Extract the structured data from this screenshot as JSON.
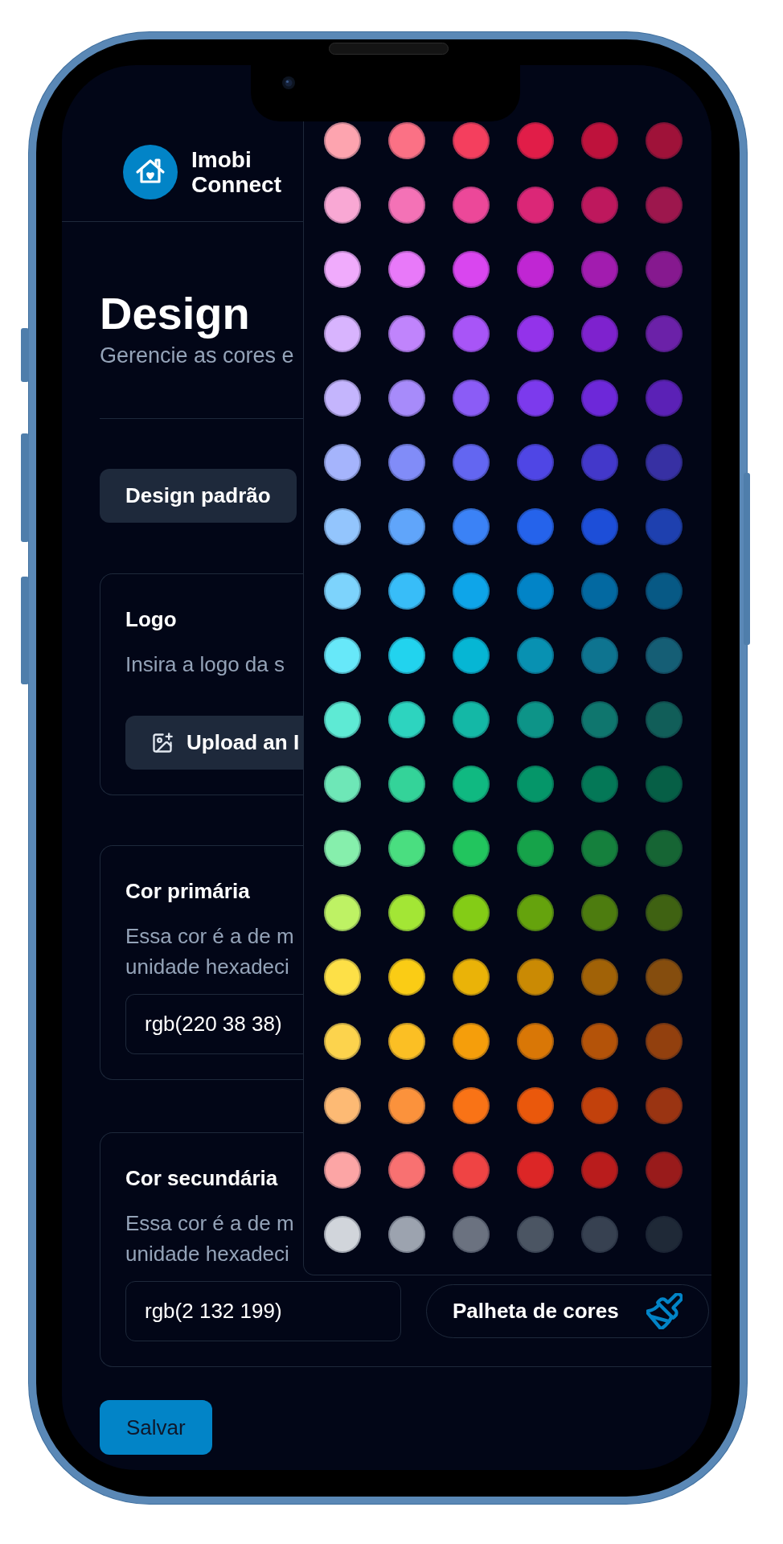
{
  "brand": {
    "name": "Imobi Connect"
  },
  "page": {
    "title": "Design",
    "subtitle": "Gerencie as cores e"
  },
  "default_design_button": {
    "label": "Design padrão"
  },
  "sections": [
    {
      "kind": "logo",
      "title": "Logo",
      "description_lines": [
        "Insira a logo da s"
      ],
      "upload_button": {
        "label": "Upload an I"
      }
    },
    {
      "kind": "color",
      "title": "Cor primária",
      "description_lines": [
        "Essa cor é a de m",
        "unidade hexadeci"
      ],
      "value": "rgb(220 38 38)"
    },
    {
      "kind": "color",
      "title": "Cor secundária",
      "description_lines": [
        "Essa cor é a de m",
        "unidade hexadeci"
      ],
      "value": "rgb(2 132 199)",
      "palette_button": {
        "label": "Palheta de cores"
      }
    }
  ],
  "color_palette": {
    "rows": [
      {
        "swatches": [
          {
            "color": "#fda4af"
          },
          {
            "color": "#fb7185"
          },
          {
            "color": "#f43f5e"
          },
          {
            "color": "#e11d48"
          },
          {
            "color": "#be123c"
          },
          {
            "color": "#9f1239"
          }
        ]
      },
      {
        "swatches": [
          {
            "color": "#f9a8d4"
          },
          {
            "color": "#f472b6"
          },
          {
            "color": "#ec4899"
          },
          {
            "color": "#db2777"
          },
          {
            "color": "#be185d"
          },
          {
            "color": "#9d174d"
          }
        ]
      },
      {
        "swatches": [
          {
            "color": "#f0abfc"
          },
          {
            "color": "#e879f9"
          },
          {
            "color": "#d946ef"
          },
          {
            "color": "#c026d3"
          },
          {
            "color": "#a21caf"
          },
          {
            "color": "#86198f"
          }
        ]
      },
      {
        "swatches": [
          {
            "color": "#d8b4fe"
          },
          {
            "color": "#c084fc"
          },
          {
            "color": "#a855f7"
          },
          {
            "color": "#9333ea"
          },
          {
            "color": "#7e22ce"
          },
          {
            "color": "#6b21a8"
          }
        ]
      },
      {
        "swatches": [
          {
            "color": "#c4b5fd"
          },
          {
            "color": "#a78bfa"
          },
          {
            "color": "#8b5cf6"
          },
          {
            "color": "#7c3aed"
          },
          {
            "color": "#6d28d9"
          },
          {
            "color": "#5b21b6"
          }
        ]
      },
      {
        "swatches": [
          {
            "color": "#a5b4fc"
          },
          {
            "color": "#818cf8"
          },
          {
            "color": "#6366f1"
          },
          {
            "color": "#4f46e5"
          },
          {
            "color": "#4338ca"
          },
          {
            "color": "#3730a3"
          }
        ]
      },
      {
        "swatches": [
          {
            "color": "#93c5fd"
          },
          {
            "color": "#60a5fa"
          },
          {
            "color": "#3b82f6"
          },
          {
            "color": "#2563eb"
          },
          {
            "color": "#1d4ed8"
          },
          {
            "color": "#1e40af"
          }
        ]
      },
      {
        "swatches": [
          {
            "color": "#7dd3fc"
          },
          {
            "color": "#38bdf8"
          },
          {
            "color": "#0ea5e9"
          },
          {
            "color": "#0284c7"
          },
          {
            "color": "#0369a1"
          },
          {
            "color": "#075985"
          }
        ]
      },
      {
        "swatches": [
          {
            "color": "#67e8f9"
          },
          {
            "color": "#22d3ee"
          },
          {
            "color": "#06b6d4"
          },
          {
            "color": "#0891b2"
          },
          {
            "color": "#0e7490"
          },
          {
            "color": "#155e75"
          }
        ]
      },
      {
        "swatches": [
          {
            "color": "#5eead4"
          },
          {
            "color": "#2dd4bf"
          },
          {
            "color": "#14b8a6"
          },
          {
            "color": "#0d9488"
          },
          {
            "color": "#0f766e"
          },
          {
            "color": "#115e59"
          }
        ]
      },
      {
        "swatches": [
          {
            "color": "#6ee7b7"
          },
          {
            "color": "#34d399"
          },
          {
            "color": "#10b981"
          },
          {
            "color": "#059669"
          },
          {
            "color": "#047857"
          },
          {
            "color": "#065f46"
          }
        ]
      },
      {
        "swatches": [
          {
            "color": "#86efac"
          },
          {
            "color": "#4ade80"
          },
          {
            "color": "#22c55e"
          },
          {
            "color": "#16a34a"
          },
          {
            "color": "#15803d"
          },
          {
            "color": "#166534"
          }
        ]
      },
      {
        "swatches": [
          {
            "color": "#bef264"
          },
          {
            "color": "#a3e635"
          },
          {
            "color": "#84cc16"
          },
          {
            "color": "#65a30d"
          },
          {
            "color": "#4d7c0f"
          },
          {
            "color": "#3f6212"
          }
        ]
      },
      {
        "swatches": [
          {
            "color": "#fde047"
          },
          {
            "color": "#facc15"
          },
          {
            "color": "#eab308"
          },
          {
            "color": "#ca8a04"
          },
          {
            "color": "#a16207"
          },
          {
            "color": "#854d0e"
          }
        ]
      },
      {
        "swatches": [
          {
            "color": "#fcd34d"
          },
          {
            "color": "#fbbf24"
          },
          {
            "color": "#f59e0b"
          },
          {
            "color": "#d97706"
          },
          {
            "color": "#b45309"
          },
          {
            "color": "#92400e"
          }
        ]
      },
      {
        "swatches": [
          {
            "color": "#fdba74"
          },
          {
            "color": "#fb923c"
          },
          {
            "color": "#f97316"
          },
          {
            "color": "#ea580c"
          },
          {
            "color": "#c2410c"
          },
          {
            "color": "#9a3412"
          }
        ]
      },
      {
        "swatches": [
          {
            "color": "#fca5a5"
          },
          {
            "color": "#f87171"
          },
          {
            "color": "#ef4444"
          },
          {
            "color": "#dc2626"
          },
          {
            "color": "#b91c1c"
          },
          {
            "color": "#991b1b"
          }
        ]
      },
      {
        "swatches": [
          {
            "color": "#d1d5db"
          },
          {
            "color": "#9ca3af"
          },
          {
            "color": "#6b7280"
          },
          {
            "color": "#4b5563"
          },
          {
            "color": "#374151"
          },
          {
            "color": "#1f2937"
          }
        ]
      }
    ]
  },
  "save_button": {
    "label": "Salvar"
  }
}
